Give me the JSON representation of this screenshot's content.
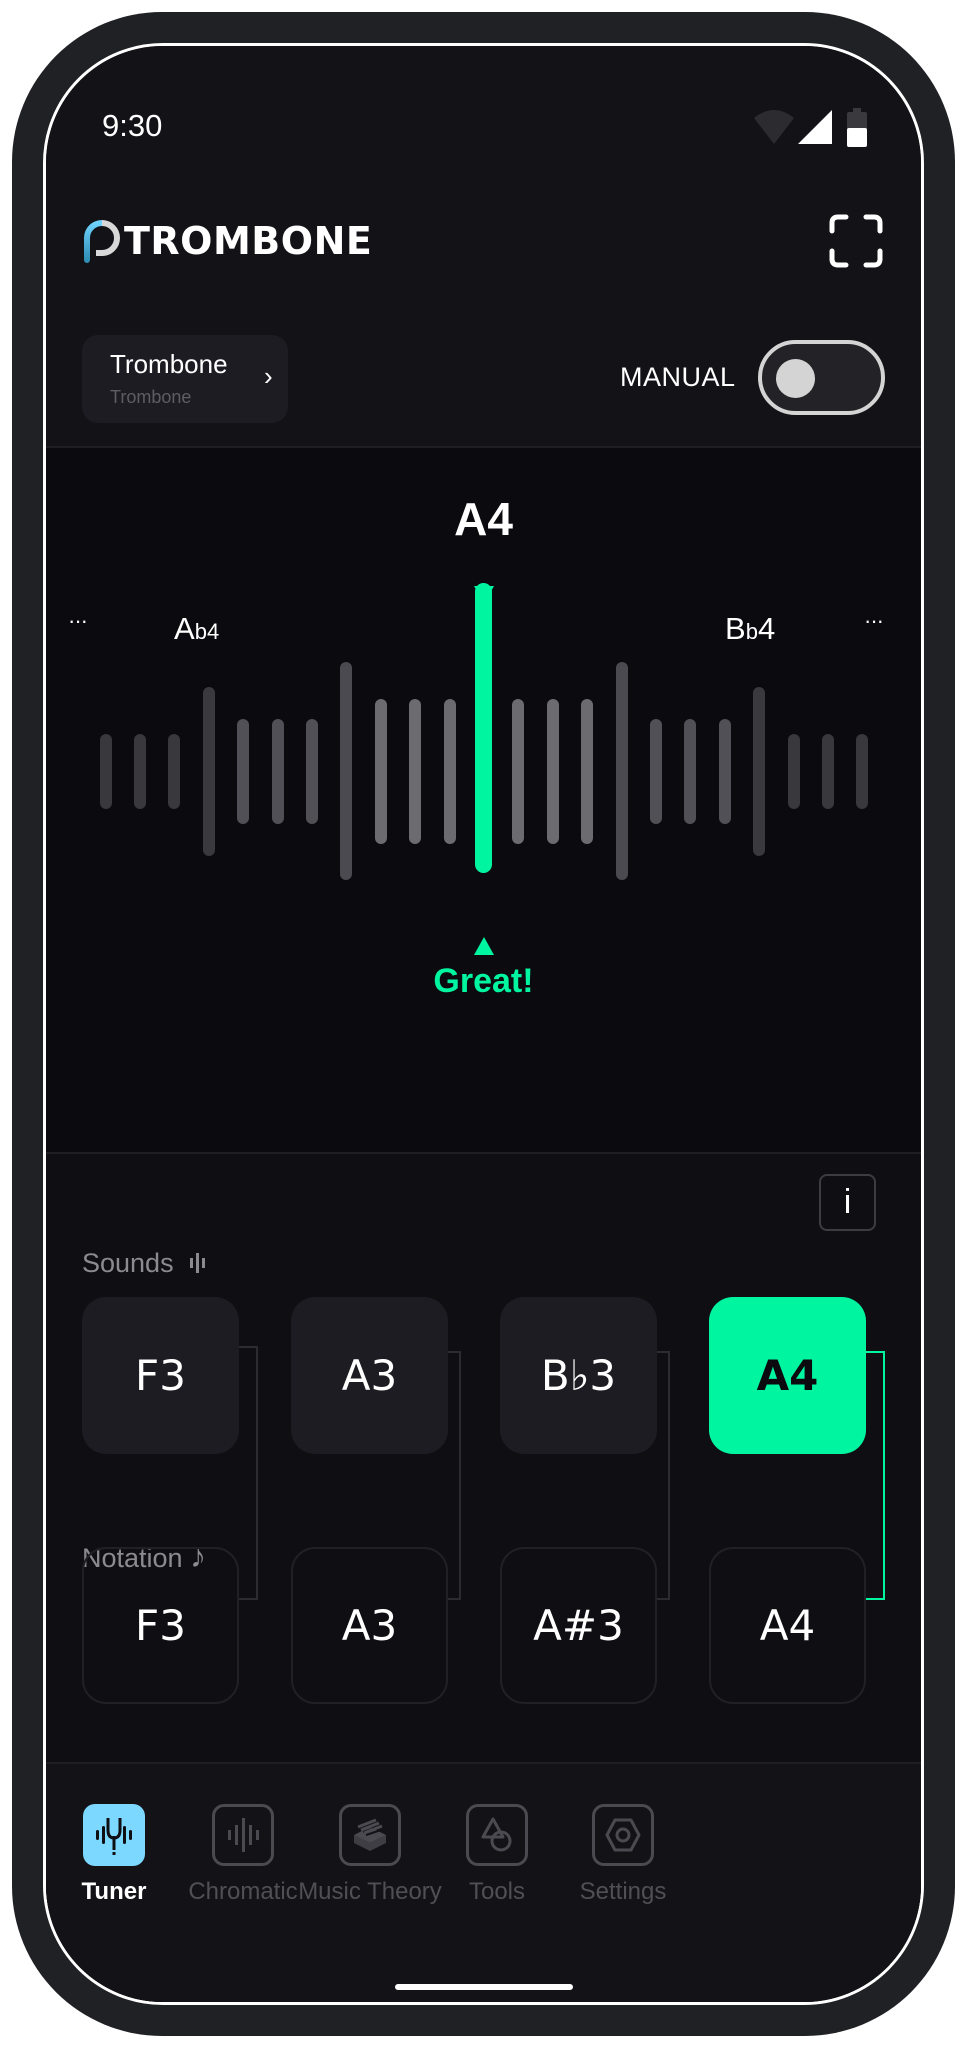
{
  "status_bar": {
    "time": "9:30",
    "wifi_icon": "wifi-off-icon",
    "signal_icon": "cellular-signal-icon",
    "battery_icon": "battery-half-icon"
  },
  "header": {
    "app_name": "TROMBONE",
    "fullscreen_icon": "fullscreen-icon"
  },
  "instrument_selector": {
    "title": "Trombone",
    "subtitle": "Trombone",
    "chevron": "›"
  },
  "manual_toggle": {
    "label": "MANUAL",
    "on": false
  },
  "tuner": {
    "target_note": "A4",
    "left_note": {
      "letter": "A",
      "accidental": "b",
      "octave": "4"
    },
    "right_note": {
      "letter": "B",
      "accidental": "b",
      "octave": "4"
    },
    "left_more": "···",
    "right_more": "···",
    "feedback": "Great!",
    "accent_color": "#00f5a0",
    "cents_offset": 0
  },
  "info_button": {
    "label": "i"
  },
  "sounds": {
    "label": "Sounds",
    "icon": "sound-wave-icon",
    "notes": [
      "F3",
      "A3",
      "B♭3",
      "A4"
    ],
    "active_index": 3
  },
  "notation": {
    "label": "Notation",
    "icon": "♪",
    "notes": [
      "F3",
      "A3",
      "A#3",
      "A4"
    ]
  },
  "bottom_nav": {
    "items": [
      {
        "label": "Tuner",
        "icon": "tuning-fork-icon",
        "active": true
      },
      {
        "label": "Chromatic",
        "icon": "waveform-icon",
        "active": false
      },
      {
        "label": "Music Theory",
        "icon": "book-stack-icon",
        "active": false
      },
      {
        "label": "Tools",
        "icon": "shapes-icon",
        "active": false
      },
      {
        "label": "Settings",
        "icon": "gear-hexagon-icon",
        "active": false
      }
    ],
    "active_color": "#7dd8ff"
  }
}
